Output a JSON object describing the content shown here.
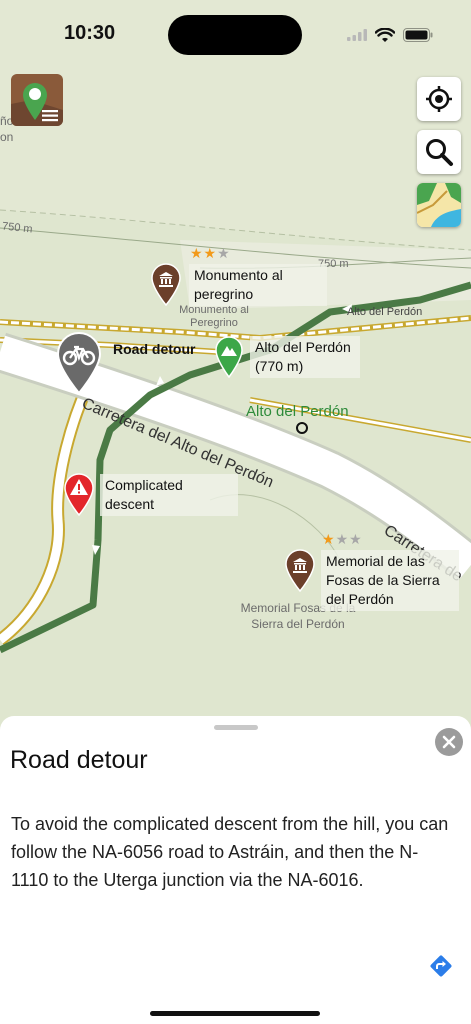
{
  "status_bar": {
    "time": "10:30"
  },
  "map": {
    "contours": [
      {
        "label": "750 m"
      },
      {
        "label": "750 m"
      }
    ],
    "road_name_left": "Carretera del Alto del Perdón",
    "road_name_right": "Carretera de",
    "peak_name": "Alto del Perdón",
    "top_road_label": "Alto del Perdón",
    "monument_map_label": "Monumento al Peregrino",
    "memorial_map_label": "Memorial Fosas de la Sierra del Perdón",
    "left_edge_fragment_1": "ño",
    "left_edge_fragment_2": "on",
    "pois": {
      "monument": {
        "label": "Monumento al peregrino",
        "rating": 2,
        "max_rating": 3
      },
      "road_detour": {
        "label": "Road detour"
      },
      "alto_perdon": {
        "label": "Alto del Perdón (770 m)"
      },
      "complicated_descent": {
        "label": "Complicated descent"
      },
      "memorial": {
        "label": "Memorial de las Fosas de la Sierra del Perdón",
        "rating": 1,
        "max_rating": 3
      }
    },
    "colors": {
      "route": "#4a7a45",
      "road_fill": "#ffffff",
      "road_outline": "#c8a830",
      "map_bg": "#dfe6cf"
    }
  },
  "controls": {
    "locate_icon": "crosshair-icon",
    "search_icon": "search-icon",
    "layers_icon": "map-layers-icon"
  },
  "sheet": {
    "title": "Road detour",
    "description": "To avoid the complicated descent from the hill, you can follow the NA-6056 road to Astráin, and then the N-1110 to the Uterga junction via the NA-6016."
  }
}
